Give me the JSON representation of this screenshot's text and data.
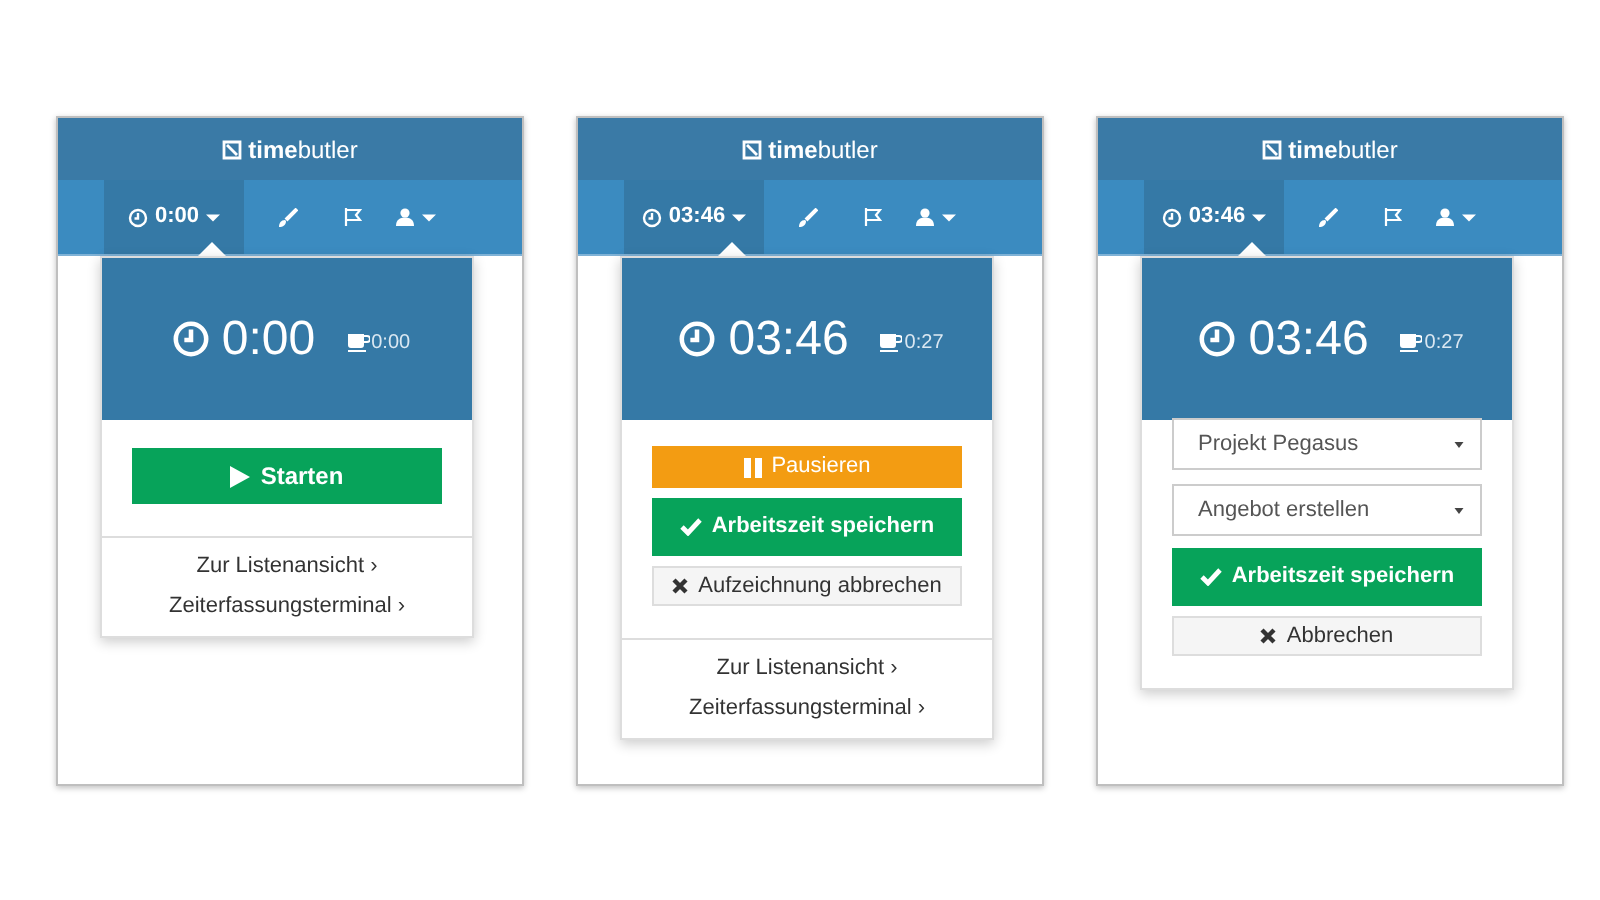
{
  "panels": [
    {
      "logo": "**time**butler",
      "timer_tab": {
        "label": "0:00",
        "selected": true
      },
      "dropdown": {
        "time": "0:00",
        "break_time": "0:00",
        "actions": [
          {
            "kind": "start",
            "label": "Starten"
          }
        ],
        "links": [
          "Zur Listenansicht ›",
          "Zeiterfassungsterminal ›"
        ]
      }
    },
    {
      "logo": "**time**butler",
      "timer_tab": {
        "label": "03:46",
        "selected": true
      },
      "dropdown": {
        "time": "03:46",
        "break_time": "0:27",
        "actions": [
          {
            "kind": "pause",
            "label": "Pausieren"
          },
          {
            "kind": "save",
            "label": "Arbeitszeit speichern"
          },
          {
            "kind": "cancel",
            "label": "Aufzeichnung abbrechen"
          }
        ],
        "links": [
          "Zur Listenansicht ›",
          "Zeiterfassungsterminal ›"
        ]
      }
    },
    {
      "logo": "**time**butler",
      "timer_tab": {
        "label": "03:46",
        "selected": true
      },
      "dropdown": {
        "time": "03:46",
        "break_time": "0:27",
        "actions": [
          {
            "kind": "select",
            "value": "Projekt Pegasus"
          },
          {
            "kind": "select",
            "value": "Angebot erstellen"
          },
          {
            "kind": "save",
            "label": "Arbeitszeit speichern"
          },
          {
            "kind": "cancel",
            "label": "Abbrechen"
          }
        ]
      }
    }
  ]
}
